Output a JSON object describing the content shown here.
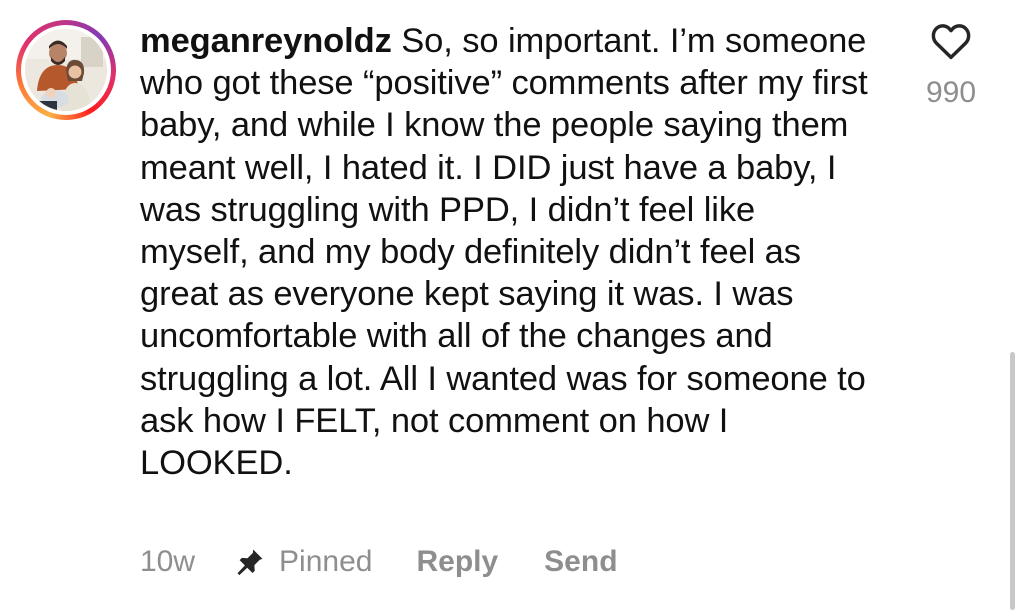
{
  "comment": {
    "username": "meganreynoldz",
    "text": "So, so important. I’m someone who got these “positive” comments after my first baby, and while I know the people saying them meant well, I hated it. I DID just have a baby, I was struggling with PPD, I didn’t feel like myself, and my body definitely didn’t feel as great as everyone kept saying it was. I was uncomfortable with all of the changes and struggling a lot. All I wanted was for someone to ask how I FELT, not comment on how I LOOKED.",
    "like_count": "990",
    "time_ago": "10w",
    "pinned_label": "Pinned",
    "reply_label": "Reply",
    "send_label": "Send"
  },
  "icons": {
    "like": "heart-outline-icon",
    "pin": "pin-icon"
  },
  "colors": {
    "text": "#111111",
    "muted": "#8e8e8e",
    "avatar_ring": [
      "#fcaf45",
      "#e1306c",
      "#833ab4"
    ]
  }
}
